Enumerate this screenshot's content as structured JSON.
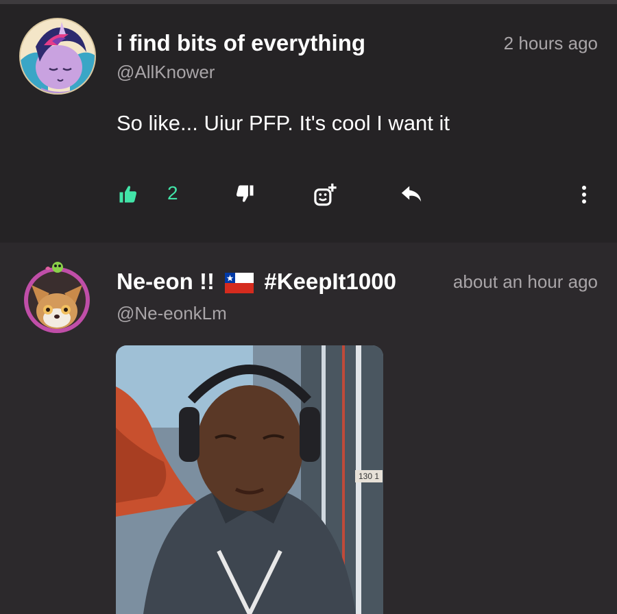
{
  "posts": [
    {
      "author_name": "i find bits of everything",
      "handle": "@AllKnower",
      "time": "2 hours ago",
      "text": "So like... Uiur PFP. It's cool I want it",
      "like_count": "2",
      "avatar_icon": "pony-avatar-icon"
    },
    {
      "author_name": "Ne-eon !!",
      "hashtag": "#KeepIt1000",
      "handle": "@Ne-eonkLm",
      "time": "about an hour ago",
      "avatar_icon": "fox-avatar-icon",
      "media_label": "130 1"
    }
  ],
  "colors": {
    "accent_green": "#42e4a8",
    "background": "#2c292c",
    "post_background": "#252325",
    "muted_text": "#a9a5a8"
  }
}
